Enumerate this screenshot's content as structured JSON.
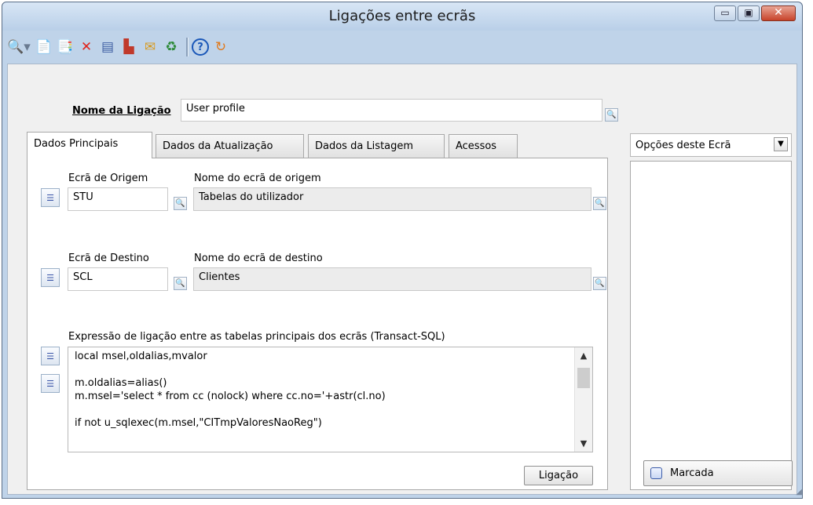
{
  "window": {
    "title": "Ligações entre ecrãs",
    "controls": {
      "minimize": "▭",
      "maximize": "▣",
      "close": "✕"
    }
  },
  "toolbar": {
    "icons": [
      {
        "name": "search-icon",
        "glyph": "🔍▾",
        "color": "#6a7b91"
      },
      {
        "name": "new-document-icon",
        "glyph": "📄",
        "color": "#5f88c4"
      },
      {
        "name": "copy-document-icon",
        "glyph": "📑",
        "color": "#5f88c4"
      },
      {
        "name": "delete-icon",
        "glyph": "✕",
        "color": "#e0241c"
      },
      {
        "name": "form-icon",
        "glyph": "▤",
        "color": "#3f5fa3"
      },
      {
        "name": "hierarchy-icon",
        "glyph": "▙",
        "color": "#c0392b"
      },
      {
        "name": "mail-icon",
        "glyph": "✉",
        "color": "#d79a1f"
      },
      {
        "name": "refresh-icon",
        "glyph": "♻",
        "color": "#2e8b3a"
      },
      {
        "name": "help-icon",
        "glyph": "?",
        "color": "#1a57b8"
      },
      {
        "name": "sync-icon",
        "glyph": "↻",
        "color": "#e0791c"
      }
    ]
  },
  "form": {
    "nome_label": "Nome da Ligação",
    "nome_value": "User profile"
  },
  "tabs": [
    {
      "label": "Dados Principais",
      "active": true
    },
    {
      "label": "Dados da Atualização",
      "active": false
    },
    {
      "label": "Dados da Listagem",
      "active": false
    },
    {
      "label": "Acessos",
      "active": false
    }
  ],
  "origem": {
    "code_label": "Ecrã de Origem",
    "name_label": "Nome do ecrã de origem",
    "code_value": "STU",
    "name_value": "Tabelas do utilizador"
  },
  "destino": {
    "code_label": "Ecrã de Destino",
    "name_label": "Nome do ecrã de destino",
    "code_value": "SCL",
    "name_value": "Clientes"
  },
  "expression": {
    "label": "Expressão de ligação entre as tabelas principais dos ecrãs (Transact-SQL)",
    "lines": [
      "local msel,oldalias,mvalor",
      "",
      "m.oldalias=alias()",
      "m.msel='select * from cc (nolock) where cc.no='+astr(cl.no)",
      "",
      "if not u_sqlexec(m.msel,\"CITmpValoresNaoReg\")"
    ]
  },
  "ligacao_button": "Ligação",
  "options": {
    "combo_value": "Opções deste Ecrã",
    "marcada_label": "Marcada"
  }
}
